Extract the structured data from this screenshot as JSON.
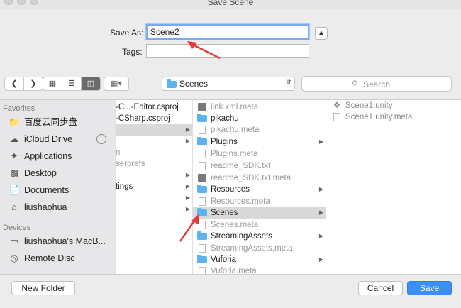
{
  "window": {
    "title": "Save Scene"
  },
  "form": {
    "save_as_label": "Save As:",
    "save_as_value": "Scene2",
    "tags_label": "Tags:",
    "tags_value": ""
  },
  "toolbar": {
    "current_folder": "Scenes",
    "search_placeholder": "Search",
    "view_mode": "columns"
  },
  "sidebar": {
    "favorites_label": "Favorites",
    "favorites": [
      {
        "label": "百度云同步盘",
        "icon": "folder-icon"
      },
      {
        "label": "iCloud Drive",
        "icon": "cloud-icon"
      },
      {
        "label": "Applications",
        "icon": "applications-icon"
      },
      {
        "label": "Desktop",
        "icon": "desktop-icon"
      },
      {
        "label": "Documents",
        "icon": "documents-icon"
      },
      {
        "label": "liushaohua",
        "icon": "home-icon"
      }
    ],
    "devices_label": "Devices",
    "devices": [
      {
        "label": "liushaohua's MacB...",
        "icon": "laptop-icon"
      },
      {
        "label": "Remote Disc",
        "icon": "disc-icon"
      }
    ]
  },
  "column1": {
    "rows": [
      {
        "text": "-C...-Editor.csproj"
      },
      {
        "text": "-CSharp.csproj"
      },
      {
        "text": ""
      },
      {
        "text": ""
      },
      {
        "text": "n"
      },
      {
        "text": "serprefs"
      },
      {
        "text": ""
      },
      {
        "text": "tings"
      }
    ]
  },
  "column2": {
    "rows": [
      {
        "text": "link.xml.meta",
        "kind": "bin"
      },
      {
        "text": "pikachu",
        "kind": "folder"
      },
      {
        "text": "pikachu.meta",
        "kind": "doc"
      },
      {
        "text": "Plugins",
        "kind": "folder"
      },
      {
        "text": "Plugins.meta",
        "kind": "doc"
      },
      {
        "text": "readme_SDK.txt",
        "kind": "doc"
      },
      {
        "text": "readme_SDK.txt.meta",
        "kind": "bin"
      },
      {
        "text": "Resources",
        "kind": "folder"
      },
      {
        "text": "Resources.meta",
        "kind": "doc"
      },
      {
        "text": "Scenes",
        "kind": "folder"
      },
      {
        "text": "Scenes.meta",
        "kind": "doc"
      },
      {
        "text": "StreamingAssets",
        "kind": "folder"
      },
      {
        "text": "StreamingAssets.meta",
        "kind": "doc"
      },
      {
        "text": "Vuforia",
        "kind": "folder"
      },
      {
        "text": "Vuforia.meta",
        "kind": "doc"
      }
    ]
  },
  "column3": {
    "rows": [
      {
        "text": "Scene1.unity",
        "kind": "unity"
      },
      {
        "text": "Scene1.unity.meta",
        "kind": "doc"
      }
    ]
  },
  "buttons": {
    "new_folder": "New Folder",
    "cancel": "Cancel",
    "save": "Save"
  },
  "colors": {
    "accent": "#3b8ff7",
    "annotation_arrow": "#e53935",
    "folder": "#5bb4f0"
  }
}
